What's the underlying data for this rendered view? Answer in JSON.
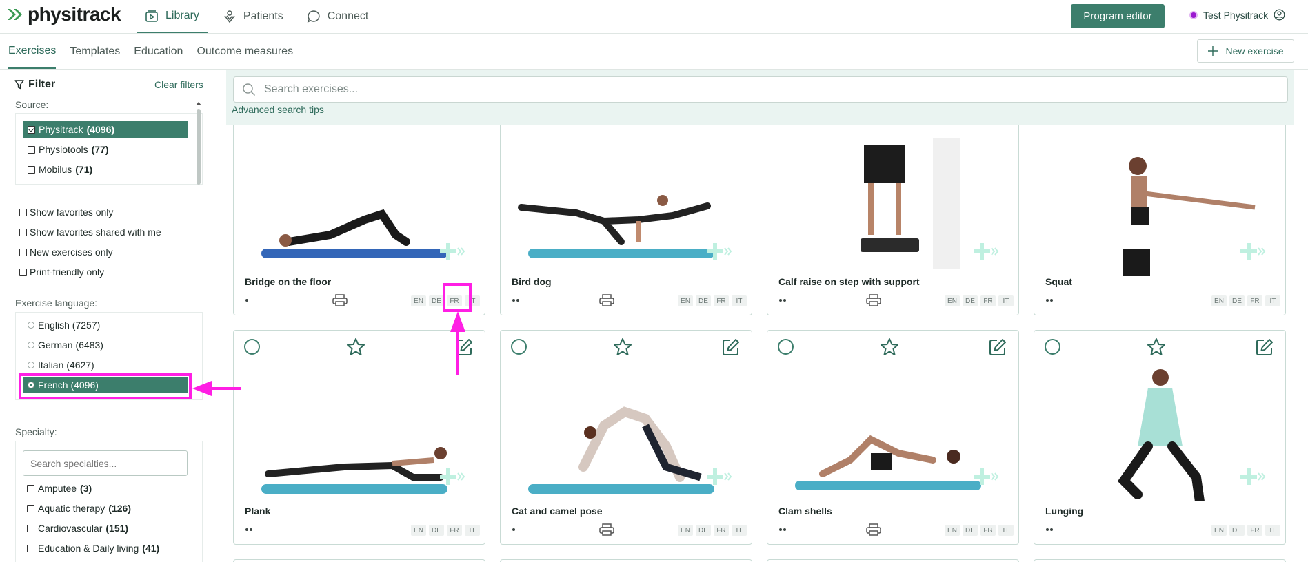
{
  "app": {
    "brand": "physitrack",
    "accent": "#3c7e6c",
    "annotation_color": "#ff1fe4"
  },
  "nav": {
    "items": [
      {
        "label": "Library",
        "icon": "library-icon"
      },
      {
        "label": "Patients",
        "icon": "patients-icon"
      },
      {
        "label": "Connect",
        "icon": "chat-icon"
      }
    ],
    "program_editor": "Program editor",
    "user": "Test Physitrack"
  },
  "subnav": {
    "tabs": [
      "Exercises",
      "Templates",
      "Education",
      "Outcome measures"
    ],
    "new_exercise": "New exercise"
  },
  "filter": {
    "title": "Filter",
    "clear": "Clear filters",
    "source_label": "Source:",
    "sources": [
      {
        "name": "Physitrack",
        "count": "(4096)",
        "checked": true
      },
      {
        "name": "Physiotools",
        "count": "(77)",
        "checked": false
      },
      {
        "name": "Mobilus",
        "count": "(71)",
        "checked": false
      }
    ],
    "options": [
      "Show favorites only",
      "Show favorites shared with me",
      "New exercises only",
      "Print-friendly only"
    ],
    "language_label": "Exercise language:",
    "languages": [
      {
        "label": "English (7257)"
      },
      {
        "label": "German (6483)"
      },
      {
        "label": "Italian (4627)"
      },
      {
        "label": "French (4096)",
        "selected": true
      }
    ],
    "specialty_label": "Specialty:",
    "specialty_placeholder": "Search specialties...",
    "specialties": [
      {
        "name": "Amputee",
        "count": "(3)"
      },
      {
        "name": "Aquatic therapy",
        "count": "(126)"
      },
      {
        "name": "Cardiovascular",
        "count": "(151)"
      },
      {
        "name": "Education & Daily living",
        "count": "(41)"
      }
    ]
  },
  "search": {
    "placeholder": "Search exercises...",
    "tips": "Advanced search tips"
  },
  "lang_codes": [
    "EN",
    "DE",
    "FR",
    "IT"
  ],
  "cards": [
    {
      "title": "Bridge on the floor",
      "level": 1,
      "printable": true
    },
    {
      "title": "Bird dog",
      "level": 2,
      "printable": true
    },
    {
      "title": "Calf raise on step with support",
      "level": 2,
      "printable": true
    },
    {
      "title": "Squat",
      "level": 2,
      "printable": false
    },
    {
      "title": "Plank",
      "level": 2,
      "printable": false
    },
    {
      "title": "Cat and camel pose",
      "level": 1,
      "printable": true
    },
    {
      "title": "Clam shells",
      "level": 2,
      "printable": true
    },
    {
      "title": "Lunging",
      "level": 2,
      "printable": false
    }
  ]
}
